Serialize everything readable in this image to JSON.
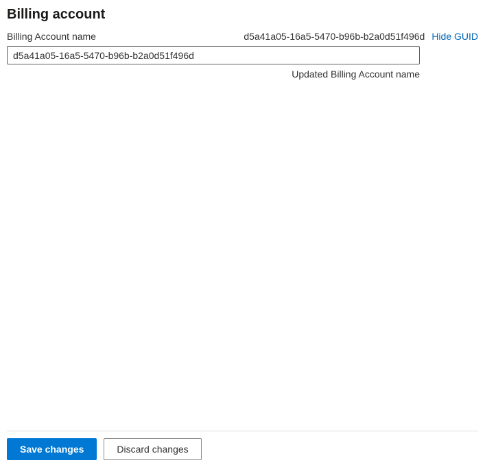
{
  "header": {
    "title": "Billing account"
  },
  "form": {
    "field_label": "Billing Account name",
    "guid_display": "d5a41a05-16a5-5470-b96b-b2a0d51f496d",
    "hide_guid_link": "Hide GUID",
    "input_value": "d5a41a05-16a5-5470-b96b-b2a0d51f496d",
    "helper_text": "Updated Billing Account name"
  },
  "footer": {
    "save_label": "Save changes",
    "discard_label": "Discard changes"
  }
}
